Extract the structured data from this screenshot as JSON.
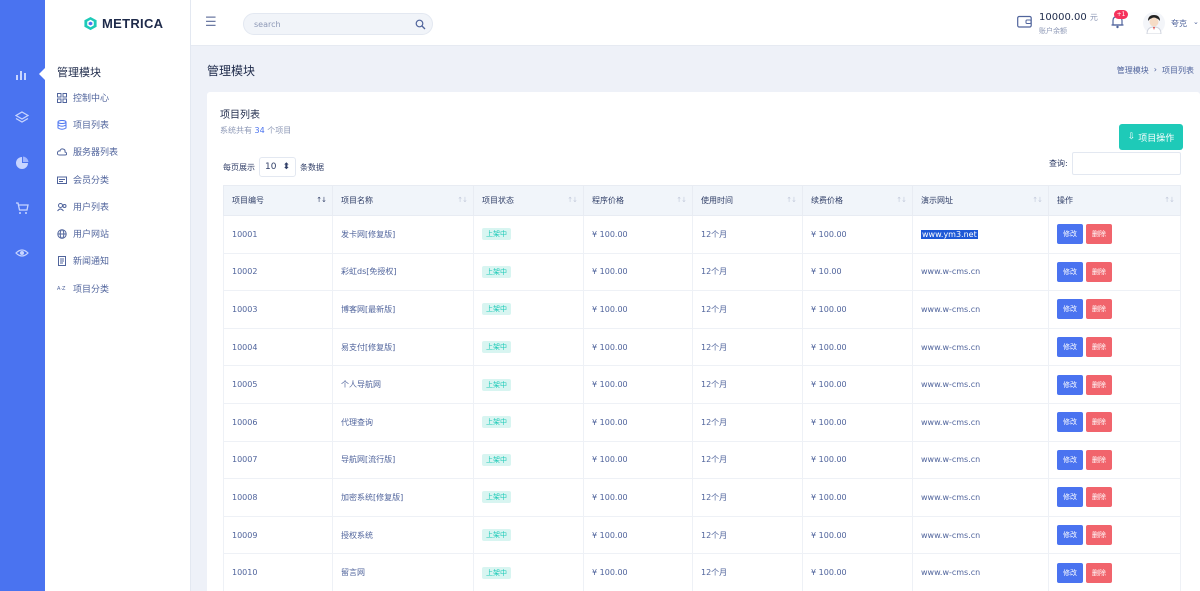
{
  "brand": {
    "name": "METRICA"
  },
  "rail": {
    "icons": [
      "bar-chart-icon",
      "layers-icon",
      "pie-chart-icon",
      "cart-icon",
      "eye-icon"
    ]
  },
  "menu": {
    "title": "管理模块",
    "items": [
      {
        "label": "控制中心",
        "icon": "dashboard-icon"
      },
      {
        "label": "项目列表",
        "icon": "database-icon"
      },
      {
        "label": "服务器列表",
        "icon": "cloud-icon"
      },
      {
        "label": "会员分类",
        "icon": "card-icon"
      },
      {
        "label": "用户列表",
        "icon": "users-icon"
      },
      {
        "label": "用户网站",
        "icon": "globe-icon"
      },
      {
        "label": "新闻通知",
        "icon": "document-icon"
      },
      {
        "label": "项目分类",
        "icon": "az-sort-icon"
      }
    ]
  },
  "topbar": {
    "search_placeholder": "search",
    "balance": "10000.00",
    "balance_unit": "元",
    "balance_label": "账户余额",
    "notification_badge": "+1",
    "username": "夸克"
  },
  "page": {
    "title": "管理模块",
    "breadcrumb": [
      "管理模块",
      "›",
      "项目列表"
    ]
  },
  "card": {
    "title": "项目列表",
    "subtitle_prefix": "系统共有",
    "count": "34",
    "subtitle_suffix": "个项目",
    "op_button": "项目操作",
    "per_page_label": "每页展示",
    "per_page_value": "10",
    "per_page_suffix": "条数据",
    "filter_label": "查询:"
  },
  "table": {
    "headers": [
      "项目编号",
      "项目名称",
      "项目状态",
      "程序价格",
      "使用时间",
      "续费价格",
      "演示网址",
      "操作"
    ],
    "edit_label": "修改",
    "delete_label": "删除",
    "rows": [
      {
        "id": "10001",
        "name": "发卡网[修复版]",
        "status": "上架中",
        "price": "¥ 100.00",
        "duration": "12个月",
        "renew": "¥ 100.00",
        "url": "www.ym3.net"
      },
      {
        "id": "10002",
        "name": "彩虹ds[免授权]",
        "status": "上架中",
        "price": "¥ 100.00",
        "duration": "12个月",
        "renew": "¥ 10.00",
        "url": "www.w-cms.cn"
      },
      {
        "id": "10003",
        "name": "博客网[最新版]",
        "status": "上架中",
        "price": "¥ 100.00",
        "duration": "12个月",
        "renew": "¥ 100.00",
        "url": "www.w-cms.cn"
      },
      {
        "id": "10004",
        "name": "易支付[修复版]",
        "status": "上架中",
        "price": "¥ 100.00",
        "duration": "12个月",
        "renew": "¥ 100.00",
        "url": "www.w-cms.cn"
      },
      {
        "id": "10005",
        "name": "个人导航网",
        "status": "上架中",
        "price": "¥ 100.00",
        "duration": "12个月",
        "renew": "¥ 100.00",
        "url": "www.w-cms.cn"
      },
      {
        "id": "10006",
        "name": "代理查询",
        "status": "上架中",
        "price": "¥ 100.00",
        "duration": "12个月",
        "renew": "¥ 100.00",
        "url": "www.w-cms.cn"
      },
      {
        "id": "10007",
        "name": "导航网[流行版]",
        "status": "上架中",
        "price": "¥ 100.00",
        "duration": "12个月",
        "renew": "¥ 100.00",
        "url": "www.w-cms.cn"
      },
      {
        "id": "10008",
        "name": "加密系统[修复版]",
        "status": "上架中",
        "price": "¥ 100.00",
        "duration": "12个月",
        "renew": "¥ 100.00",
        "url": "www.w-cms.cn"
      },
      {
        "id": "10009",
        "name": "授权系统",
        "status": "上架中",
        "price": "¥ 100.00",
        "duration": "12个月",
        "renew": "¥ 100.00",
        "url": "www.w-cms.cn"
      },
      {
        "id": "10010",
        "name": "留言网",
        "status": "上架中",
        "price": "¥ 100.00",
        "duration": "12个月",
        "renew": "¥ 100.00",
        "url": "www.w-cms.cn"
      }
    ]
  },
  "colors": {
    "primary": "#4a73f0",
    "success": "#1ecab8",
    "danger": "#f1646c"
  }
}
